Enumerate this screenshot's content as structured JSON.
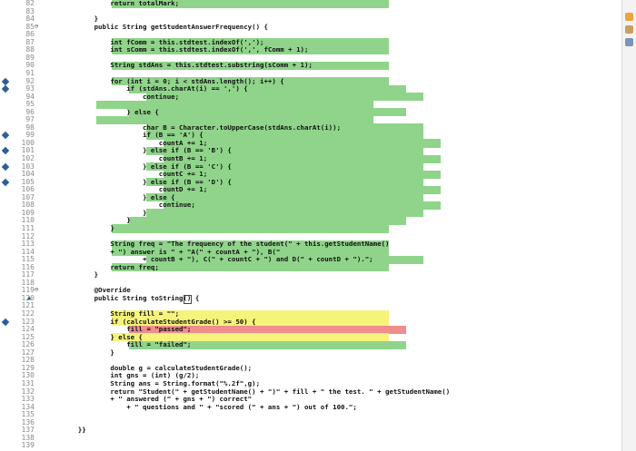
{
  "editor": {
    "lines": [
      {
        "n": "82",
        "code": "            return totalMark;",
        "hl": "green"
      },
      {
        "n": "83",
        "code": ""
      },
      {
        "n": "84",
        "code": "        }"
      },
      {
        "n": "85",
        "code": "        public String getStudentAnswerFrequency() {",
        "fold": true
      },
      {
        "n": "86",
        "code": ""
      },
      {
        "n": "87",
        "code": "            int fComm = this.stdtest.indexOf(',');",
        "hl": "green"
      },
      {
        "n": "88",
        "code": "            int sComm = this.stdtest.indexOf(',', fComm + 1);",
        "hl": "green"
      },
      {
        "n": "89",
        "code": ""
      },
      {
        "n": "90",
        "code": "            String stdAns = this.stdtest.substring(sComm + 1);",
        "hl": "green"
      },
      {
        "n": "91",
        "code": ""
      },
      {
        "n": "92",
        "code": "            for (int i = 0; i < stdAns.length(); i++) {",
        "hl": "green",
        "mark": true
      },
      {
        "n": "93",
        "code": "                if (stdAns.charAt(i) == ',') {",
        "hl": "green",
        "mark": true
      },
      {
        "n": "94",
        "code": "                    continue;",
        "hl": "green"
      },
      {
        "n": "95",
        "code": "",
        "hl": "green"
      },
      {
        "n": "96",
        "code": "                } else {",
        "hl": "green"
      },
      {
        "n": "97",
        "code": "",
        "hl": "green"
      },
      {
        "n": "98",
        "code": "                    char B = Character.toUpperCase(stdAns.charAt(i));",
        "hl": "green"
      },
      {
        "n": "99",
        "code": "                    if (B == 'A') {",
        "hl": "green",
        "mark": true
      },
      {
        "n": "100",
        "code": "                        countA += 1;",
        "hl": "green"
      },
      {
        "n": "101",
        "code": "                    } else if (B == 'B') {",
        "hl": "green",
        "mark": true
      },
      {
        "n": "102",
        "code": "                        countB += 1;",
        "hl": "green"
      },
      {
        "n": "103",
        "code": "                    } else if (B == 'C') {",
        "hl": "green",
        "mark": true
      },
      {
        "n": "104",
        "code": "                        countC += 1;",
        "hl": "green"
      },
      {
        "n": "105",
        "code": "                    } else if (B == 'D') {",
        "hl": "green",
        "mark": true
      },
      {
        "n": "106",
        "code": "                        countD += 1;",
        "hl": "green"
      },
      {
        "n": "107",
        "code": "                    } else {",
        "hl": "green"
      },
      {
        "n": "108",
        "code": "                        continue;",
        "hl": "green"
      },
      {
        "n": "109",
        "code": "                    }",
        "hl": "green"
      },
      {
        "n": "110",
        "code": "                }",
        "hl": "green"
      },
      {
        "n": "111",
        "code": "            }",
        "hl": "green"
      },
      {
        "n": "112",
        "code": ""
      },
      {
        "n": "113",
        "code": "            String freq = \"The frequency of the student(\" + this.getStudentName()",
        "hl": "green"
      },
      {
        "n": "114",
        "code": "            + \") answer is \" + \"A(\" + countA + \"), B(\"",
        "hl": "green"
      },
      {
        "n": "115",
        "code": "                    + countB + \"), C(\" + countC + \") and D(\" + countD + \").\";",
        "hl": "green"
      },
      {
        "n": "116",
        "code": "            return freq;",
        "hl": "green"
      },
      {
        "n": "117",
        "code": "        }"
      },
      {
        "n": "118",
        "code": ""
      },
      {
        "n": "119",
        "code": "        @Override",
        "fold": true
      },
      {
        "n": "120",
        "code": "        public String toString() {",
        "arrow": true
      },
      {
        "n": "121",
        "code": ""
      },
      {
        "n": "122",
        "code": "            String fill = \"\";",
        "hl": "yellow"
      },
      {
        "n": "123",
        "code": "            if (calculateStudentGrade() >= 50) {",
        "hl": "yellow",
        "mark": true
      },
      {
        "n": "124",
        "code": "                fill = \"passed\";",
        "hl": "red"
      },
      {
        "n": "125",
        "code": "            } else {",
        "hl": "yellow"
      },
      {
        "n": "126",
        "code": "                fill = \"failed\";",
        "hl": "green"
      },
      {
        "n": "127",
        "code": "            }"
      },
      {
        "n": "128",
        "code": ""
      },
      {
        "n": "129",
        "code": "            double g = calculateStudentGrade();"
      },
      {
        "n": "130",
        "code": "            int gns = (int) (g/2);"
      },
      {
        "n": "131",
        "code": "            String ans = String.format(\"%.2f\",g);"
      },
      {
        "n": "132",
        "code": "            return \"Student(\" + getStudentName() + \")\" + fill + \" the test. \" + getStudentName()"
      },
      {
        "n": "133",
        "code": "            + \" answered (\" + gns + \") correct\""
      },
      {
        "n": "134",
        "code": "                + \" questions and \" + \"scored (\" + ans + \") out of 100.\";"
      },
      {
        "n": "135",
        "code": ""
      },
      {
        "n": "136",
        "code": ""
      },
      {
        "n": "137",
        "code": "    }}"
      },
      {
        "n": "138",
        "code": ""
      },
      {
        "n": "139",
        "code": ""
      }
    ]
  },
  "colors": {
    "green": "#8fd48a",
    "yellow": "#f5f37a",
    "red": "#f08d8d",
    "marker": "#2c5e9a"
  },
  "sidebar": {
    "icons": [
      "toolbar-icon-1",
      "toolbar-icon-2",
      "toolbar-icon-3"
    ]
  }
}
